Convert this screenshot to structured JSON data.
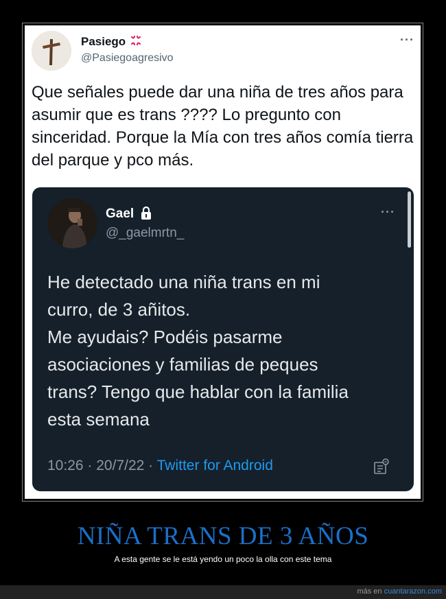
{
  "tweet": {
    "author_name": "Pasiego",
    "author_emoji": "anger-symbol-icon",
    "author_handle": "@Pasiegoagresivo",
    "more_label": "···",
    "body": "Que señales puede dar una niña de tres años para asumir que es trans ???? Lo pregunto con sinceridad. Porque la Mía con tres años comía tierra del parque y pco más."
  },
  "quoted_tweet": {
    "author_name": "Gael",
    "author_handle": "@_gaelmrtn_",
    "more_label": "···",
    "body_lines": [
      "He detectado una niña trans en mi",
      "curro, de 3 añitos.",
      "Me ayudais? Podéis pasarme",
      "asociaciones y familias de peques",
      "trans? Tengo que hablar con la familia",
      "esta semana"
    ],
    "time": "10:26",
    "date": "20/7/22",
    "separator": "·",
    "source": "Twitter for Android"
  },
  "caption": {
    "headline": "NIÑA TRANS DE 3 AÑOS",
    "subtitle": "A esta gente se le está yendo un poco la olla con este tema"
  },
  "footer": {
    "prefix": "más en ",
    "link": "cuantarazon.com"
  },
  "colors": {
    "accent": "#1d9bf0",
    "headline": "#1b6fc8",
    "quote_bg": "#15202b"
  }
}
